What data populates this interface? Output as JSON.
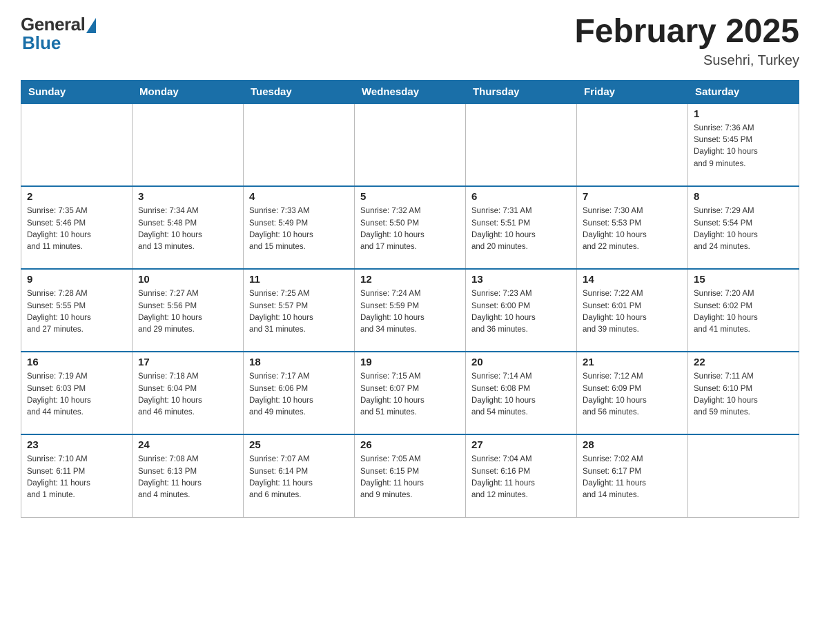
{
  "header": {
    "logo_general": "General",
    "logo_blue": "Blue",
    "month_title": "February 2025",
    "location": "Susehri, Turkey"
  },
  "calendar": {
    "days_of_week": [
      "Sunday",
      "Monday",
      "Tuesday",
      "Wednesday",
      "Thursday",
      "Friday",
      "Saturday"
    ],
    "weeks": [
      [
        {
          "day": "",
          "info": ""
        },
        {
          "day": "",
          "info": ""
        },
        {
          "day": "",
          "info": ""
        },
        {
          "day": "",
          "info": ""
        },
        {
          "day": "",
          "info": ""
        },
        {
          "day": "",
          "info": ""
        },
        {
          "day": "1",
          "info": "Sunrise: 7:36 AM\nSunset: 5:45 PM\nDaylight: 10 hours\nand 9 minutes."
        }
      ],
      [
        {
          "day": "2",
          "info": "Sunrise: 7:35 AM\nSunset: 5:46 PM\nDaylight: 10 hours\nand 11 minutes."
        },
        {
          "day": "3",
          "info": "Sunrise: 7:34 AM\nSunset: 5:48 PM\nDaylight: 10 hours\nand 13 minutes."
        },
        {
          "day": "4",
          "info": "Sunrise: 7:33 AM\nSunset: 5:49 PM\nDaylight: 10 hours\nand 15 minutes."
        },
        {
          "day": "5",
          "info": "Sunrise: 7:32 AM\nSunset: 5:50 PM\nDaylight: 10 hours\nand 17 minutes."
        },
        {
          "day": "6",
          "info": "Sunrise: 7:31 AM\nSunset: 5:51 PM\nDaylight: 10 hours\nand 20 minutes."
        },
        {
          "day": "7",
          "info": "Sunrise: 7:30 AM\nSunset: 5:53 PM\nDaylight: 10 hours\nand 22 minutes."
        },
        {
          "day": "8",
          "info": "Sunrise: 7:29 AM\nSunset: 5:54 PM\nDaylight: 10 hours\nand 24 minutes."
        }
      ],
      [
        {
          "day": "9",
          "info": "Sunrise: 7:28 AM\nSunset: 5:55 PM\nDaylight: 10 hours\nand 27 minutes."
        },
        {
          "day": "10",
          "info": "Sunrise: 7:27 AM\nSunset: 5:56 PM\nDaylight: 10 hours\nand 29 minutes."
        },
        {
          "day": "11",
          "info": "Sunrise: 7:25 AM\nSunset: 5:57 PM\nDaylight: 10 hours\nand 31 minutes."
        },
        {
          "day": "12",
          "info": "Sunrise: 7:24 AM\nSunset: 5:59 PM\nDaylight: 10 hours\nand 34 minutes."
        },
        {
          "day": "13",
          "info": "Sunrise: 7:23 AM\nSunset: 6:00 PM\nDaylight: 10 hours\nand 36 minutes."
        },
        {
          "day": "14",
          "info": "Sunrise: 7:22 AM\nSunset: 6:01 PM\nDaylight: 10 hours\nand 39 minutes."
        },
        {
          "day": "15",
          "info": "Sunrise: 7:20 AM\nSunset: 6:02 PM\nDaylight: 10 hours\nand 41 minutes."
        }
      ],
      [
        {
          "day": "16",
          "info": "Sunrise: 7:19 AM\nSunset: 6:03 PM\nDaylight: 10 hours\nand 44 minutes."
        },
        {
          "day": "17",
          "info": "Sunrise: 7:18 AM\nSunset: 6:04 PM\nDaylight: 10 hours\nand 46 minutes."
        },
        {
          "day": "18",
          "info": "Sunrise: 7:17 AM\nSunset: 6:06 PM\nDaylight: 10 hours\nand 49 minutes."
        },
        {
          "day": "19",
          "info": "Sunrise: 7:15 AM\nSunset: 6:07 PM\nDaylight: 10 hours\nand 51 minutes."
        },
        {
          "day": "20",
          "info": "Sunrise: 7:14 AM\nSunset: 6:08 PM\nDaylight: 10 hours\nand 54 minutes."
        },
        {
          "day": "21",
          "info": "Sunrise: 7:12 AM\nSunset: 6:09 PM\nDaylight: 10 hours\nand 56 minutes."
        },
        {
          "day": "22",
          "info": "Sunrise: 7:11 AM\nSunset: 6:10 PM\nDaylight: 10 hours\nand 59 minutes."
        }
      ],
      [
        {
          "day": "23",
          "info": "Sunrise: 7:10 AM\nSunset: 6:11 PM\nDaylight: 11 hours\nand 1 minute."
        },
        {
          "day": "24",
          "info": "Sunrise: 7:08 AM\nSunset: 6:13 PM\nDaylight: 11 hours\nand 4 minutes."
        },
        {
          "day": "25",
          "info": "Sunrise: 7:07 AM\nSunset: 6:14 PM\nDaylight: 11 hours\nand 6 minutes."
        },
        {
          "day": "26",
          "info": "Sunrise: 7:05 AM\nSunset: 6:15 PM\nDaylight: 11 hours\nand 9 minutes."
        },
        {
          "day": "27",
          "info": "Sunrise: 7:04 AM\nSunset: 6:16 PM\nDaylight: 11 hours\nand 12 minutes."
        },
        {
          "day": "28",
          "info": "Sunrise: 7:02 AM\nSunset: 6:17 PM\nDaylight: 11 hours\nand 14 minutes."
        },
        {
          "day": "",
          "info": ""
        }
      ]
    ]
  }
}
